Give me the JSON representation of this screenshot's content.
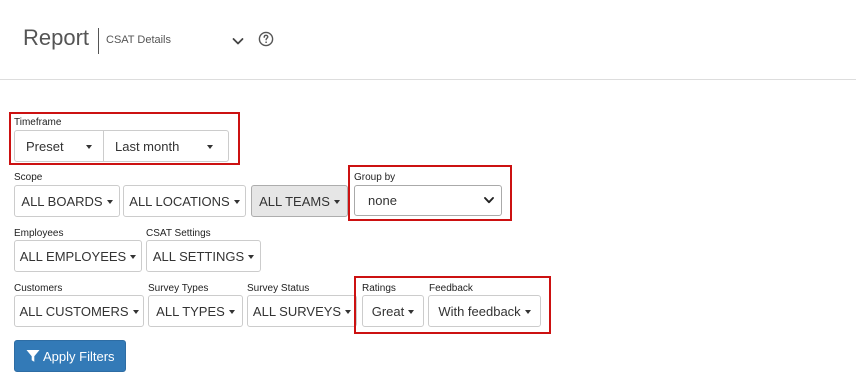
{
  "header": {
    "title": "Report",
    "report_select": "CSAT Details"
  },
  "timeframe": {
    "label": "Timeframe",
    "preset": "Preset",
    "period": "Last month"
  },
  "scope": {
    "label": "Scope",
    "boards": "ALL BOARDS",
    "locations": "ALL LOCATIONS",
    "teams": "ALL TEAMS"
  },
  "group_by": {
    "label": "Group by",
    "value": "none"
  },
  "employees": {
    "label": "Employees",
    "value": "ALL EMPLOYEES"
  },
  "csat_settings": {
    "label": "CSAT Settings",
    "value": "ALL SETTINGS"
  },
  "customers": {
    "label": "Customers",
    "value": "ALL CUSTOMERS"
  },
  "survey_types": {
    "label": "Survey Types",
    "value": "ALL TYPES"
  },
  "survey_status": {
    "label": "Survey Status",
    "value": "ALL SURVEYS"
  },
  "ratings": {
    "label": "Ratings",
    "value": "Great"
  },
  "feedback": {
    "label": "Feedback",
    "value": "With feedback"
  },
  "apply": {
    "label": "Apply Filters"
  },
  "colors": {
    "highlight": "#cc1111",
    "primary": "#337ab7"
  },
  "icons": [
    "chevron-down-icon",
    "help-icon",
    "caret-down-icon",
    "filter-icon"
  ]
}
